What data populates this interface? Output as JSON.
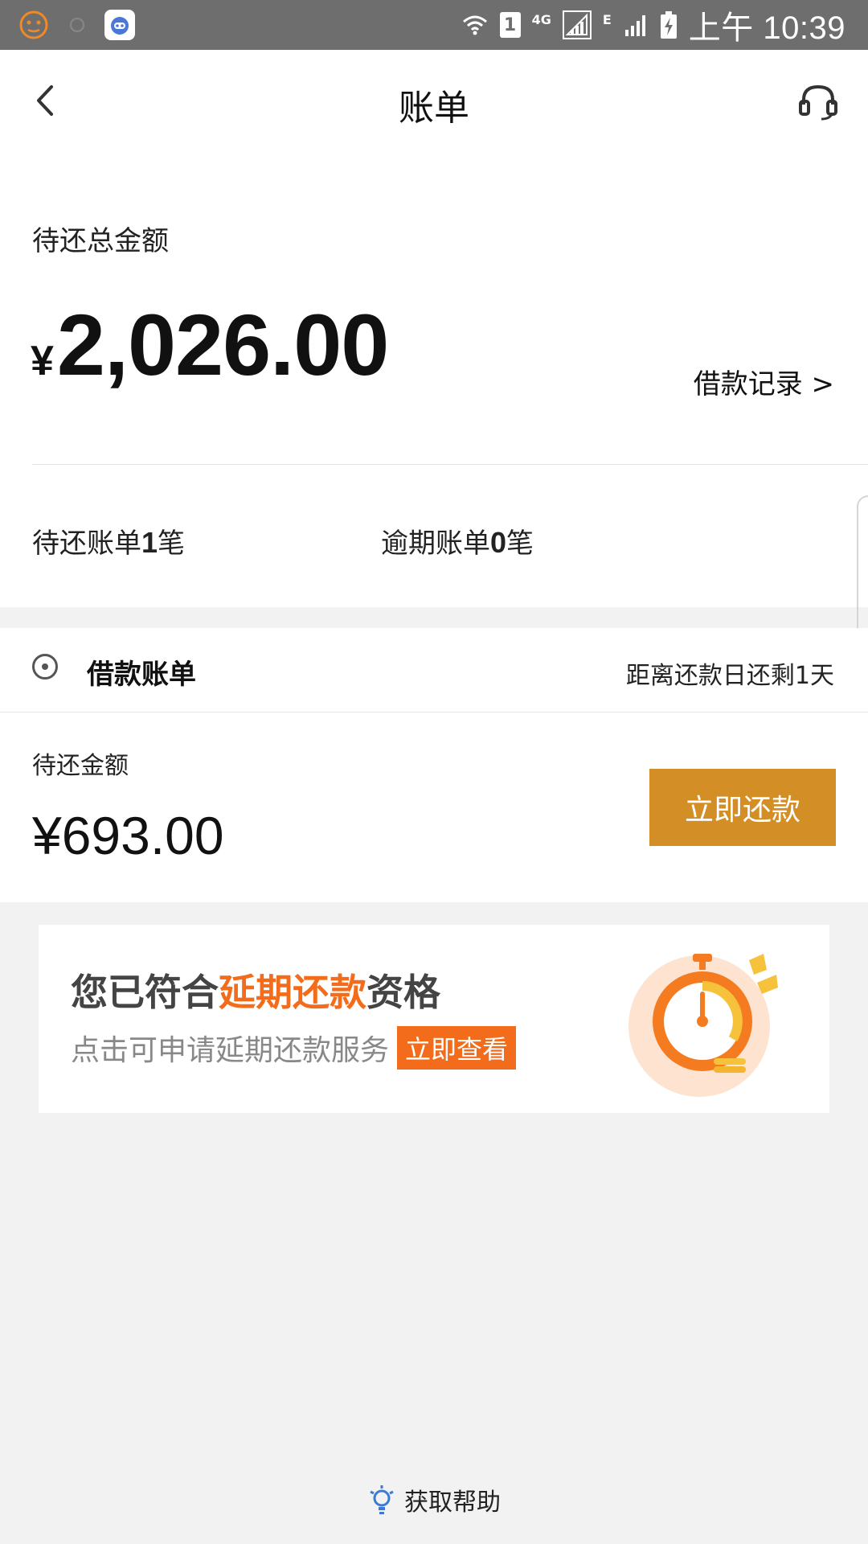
{
  "status_bar": {
    "time": "上午 10:39",
    "sim_slot": "1",
    "network_4g": "4G",
    "network_e": "E"
  },
  "header": {
    "title": "账单"
  },
  "summary": {
    "total_label": "待还总金额",
    "currency_symbol": "¥",
    "total_amount": "2,026.00",
    "loan_record_link": "借款记录 >",
    "pending_prefix": "待还账单",
    "pending_count": "1",
    "pending_suffix": "笔",
    "overdue_prefix": "逾期账单",
    "overdue_count": "0",
    "overdue_suffix": "笔"
  },
  "bill": {
    "title": "借款账单",
    "due_text": "距离还款日还剩1天",
    "due_label": "待还金额",
    "due_amount": "¥693.00",
    "pay_button": "立即还款"
  },
  "banner": {
    "line1_prefix": "您已符合",
    "line1_highlight": "延期还款",
    "line1_suffix": "资格",
    "line2": "点击可申请延期还款服务",
    "cta": "立即查看"
  },
  "footer": {
    "help_label": "获取帮助"
  },
  "colors": {
    "pay_button": "#d48e26",
    "accent_orange": "#f36c1c",
    "status_bar": "#6e6e6e"
  }
}
